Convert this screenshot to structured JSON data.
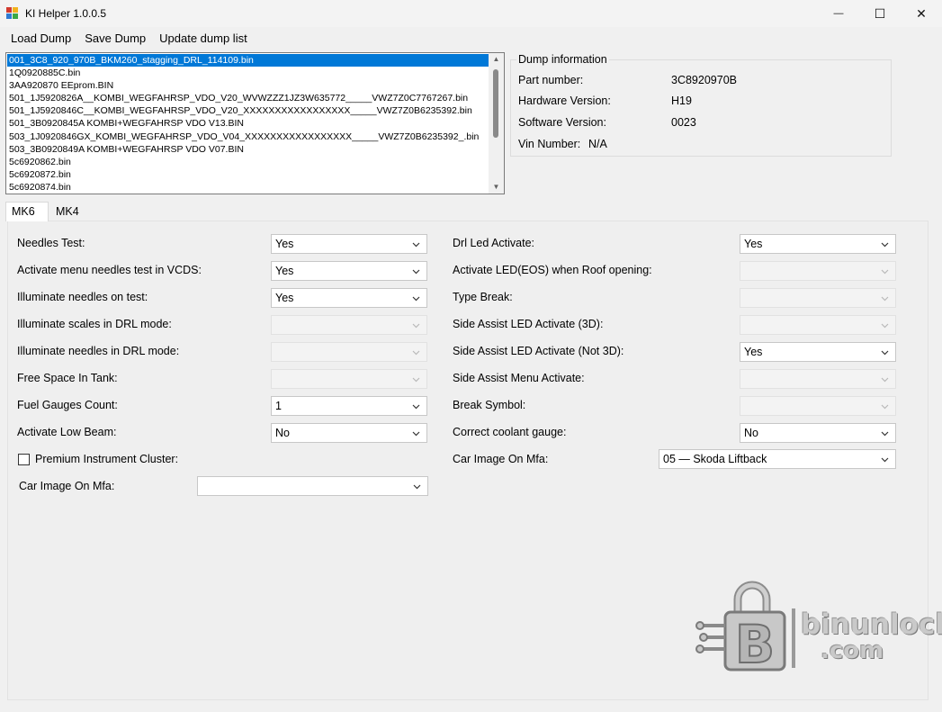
{
  "window": {
    "title": "KI Helper 1.0.0.5",
    "controls": {
      "minimize": "—",
      "maximize": "☐",
      "close": "✕"
    }
  },
  "menu": [
    "Load Dump",
    "Save Dump",
    "Update dump list"
  ],
  "dump_list": {
    "selected_index": 0,
    "items": [
      "001_3C8_920_970B_BKM260_stagging_DRL_114109.bin",
      "1Q0920885C.bin",
      "3AA920870 EEprom.BIN",
      "501_1J5920826A__KOMBI_WEGFAHRSP_VDO_V20_WVWZZZ1JZ3W635772_____VWZ7Z0C7767267.bin",
      "501_1J5920846C__KOMBI_WEGFAHRSP_VDO_V20_XXXXXXXXXXXXXXXXX_____VWZ7Z0B6235392.bin",
      "501_3B0920845A  KOMBI+WEGFAHRSP VDO V13.BIN",
      "503_1J0920846GX_KOMBI_WEGFAHRSP_VDO_V04_XXXXXXXXXXXXXXXXX_____VWZ7Z0B6235392_.bin",
      "503_3B0920849A  KOMBI+WEGFAHRSP VDO V07.BIN",
      "5c6920862.bin",
      "5c6920872.bin",
      "5c6920874.bin"
    ]
  },
  "dump_info": {
    "legend": "Dump information",
    "part_number_label": "Part number:",
    "part_number": "3C8920970B",
    "hardware_label": "Hardware Version:",
    "hardware": "H19",
    "software_label": "Software Version:",
    "software": "0023",
    "vin_label": "Vin Number:",
    "vin": "N/A"
  },
  "tabs": [
    "MK6",
    "MK4"
  ],
  "left_settings": [
    {
      "label": "Needles Test:",
      "value": "Yes",
      "enabled": true
    },
    {
      "label": "Activate menu needles test in VCDS:",
      "value": "Yes",
      "enabled": true
    },
    {
      "label": "Illuminate needles on test:",
      "value": "Yes",
      "enabled": true
    },
    {
      "label": "Illuminate scales in DRL mode:",
      "value": "",
      "enabled": false
    },
    {
      "label": "Illuminate needles in DRL mode:",
      "value": "",
      "enabled": false
    },
    {
      "label": "Free Space In Tank:",
      "value": "",
      "enabled": false
    },
    {
      "label": "Fuel Gauges Count:",
      "value": "1",
      "enabled": true
    },
    {
      "label": "Activate Low Beam:",
      "value": "No",
      "enabled": true
    }
  ],
  "premium_cluster": {
    "label": "Premium Instrument Cluster:",
    "checked": false
  },
  "left_car_image": {
    "label": "Car Image On Mfa:",
    "value": ""
  },
  "right_settings": [
    {
      "label": "Drl Led Activate:",
      "value": "Yes",
      "enabled": true
    },
    {
      "label": "Activate LED(EOS) when Roof opening:",
      "value": "",
      "enabled": false
    },
    {
      "label": "Type Break:",
      "value": "",
      "enabled": false
    },
    {
      "label": "Side Assist LED Activate (3D):",
      "value": "",
      "enabled": false
    },
    {
      "label": "Side Assist LED Activate (Not 3D):",
      "value": "Yes",
      "enabled": true
    },
    {
      "label": "Side Assist Menu Activate:",
      "value": "",
      "enabled": false
    },
    {
      "label": "Break Symbol:",
      "value": "",
      "enabled": false
    },
    {
      "label": "Correct coolant gauge:",
      "value": "No",
      "enabled": true
    }
  ],
  "right_car_image": {
    "label": "Car Image On Mfa:",
    "value": "05 — Skoda Liftback"
  },
  "watermark": {
    "name": "binunlock",
    "domain": ".com",
    "logo_letter": "B"
  }
}
